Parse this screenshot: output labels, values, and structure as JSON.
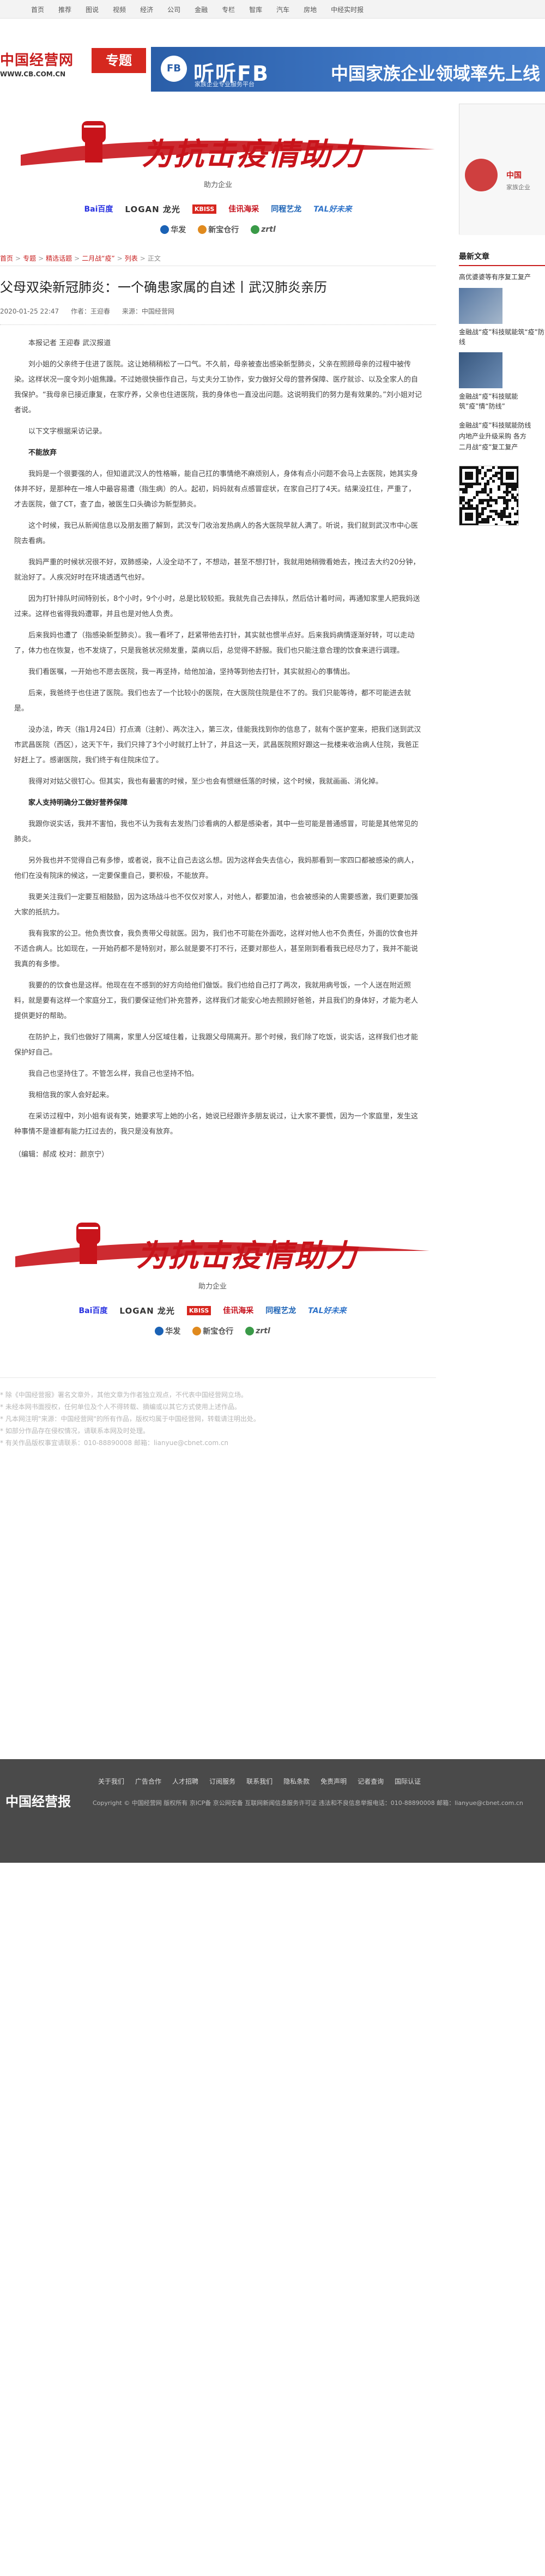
{
  "topnav": [
    "首页",
    "推荐",
    "图说",
    "视频",
    "经济",
    "公司",
    "金融",
    "专栏",
    "智库",
    "汽车",
    "房地",
    "中经实时报"
  ],
  "brand": {
    "name": "中国经营网",
    "url": "WWW.CB.COM.CN",
    "zhuanti": "专题"
  },
  "ad": {
    "logo": "FB",
    "title": "听听FB",
    "slogan": "中国家族企业领域率先上线",
    "sub": "家族企业专业服务平台"
  },
  "epidemic": {
    "slogan": "为抗击疫情助力",
    "subtitle": "助力企业",
    "sponsors_row1": [
      "Bai百度",
      "LOGAN 龙光",
      "KBISS",
      "佳讯海采",
      "同程艺龙",
      "TAL好未来"
    ],
    "sponsors_row2": [
      "华发",
      "新宝仓行",
      "zrtl"
    ]
  },
  "breadcrumb": [
    "首页",
    "专题",
    "精选话题",
    "二月战“疫”",
    "列表",
    "正文"
  ],
  "article": {
    "title": "父母双染新冠肺炎：一个确患家属的自述丨武汉肺炎亲历",
    "date": "2020-01-25 22:47",
    "author": "作者：王迎春",
    "source": "来源：中国经营网",
    "paragraphs": [
      {
        "t": "本报记者 王迎春 武汉报道",
        "s": false
      },
      {
        "t": "刘小姐的父亲终于住进了医院。这让她稍稍松了一口气。不久前，母亲被查出感染新型肺炎，父亲在照顾母亲的过程中被传染。这样状况一度令刘小姐焦躁。不过她很快振作自己，与丈夫分工协作，安力做好父母的营养保障、医疗就诊、以及全家人的自我保护。“我母亲已接近康复，在家疗养，父亲也住进医院，我的身体也一直没出问题。这说明我们的努力是有效果的。”刘小姐对记者说。",
        "s": false
      },
      {
        "t": "以下文字根据采访记录。",
        "s": false
      },
      {
        "t": "不能放弃",
        "s": true
      },
      {
        "t": "我妈是一个很要强的人，但知道武汉人的性格嘛，能自己扛的事情绝不麻烦别人，身体有点小问题不会马上去医院，她其实身体并不好，是那种在一堆人中最容易遭（指生病）的人。起初，妈妈就有点感冒症状，在家自己打了4天。结果没扛住，严重了，才去医院，做了CT，查了血，被医生口头确诊为新型肺炎。",
        "s": false
      },
      {
        "t": "这个时候，我已从新闻信息以及朋友圈了解到，武汉专门收治发热病人的各大医院早就人满了。听说，我们就到武汉市中心医院去看病。",
        "s": false
      },
      {
        "t": "我妈严重的时候状况很不好，双肺感染，人没全动不了，不想动，甚至不想打针，我就用她稍微看她去，拽过去大约20分钟，就治好了。人疾况好时在环境透透气也好。",
        "s": false
      },
      {
        "t": "因为打针排队时间特别长，8个小时，9个小时，总是比较较拒。我就先自己去排队，然后估计着时间，再通知家里人把我妈送过来。这样也省得我妈遭罪，并且也是对他人负责。",
        "s": false
      },
      {
        "t": "后来我妈也遭了（指感染新型肺炎）。我一看坏了，赶紧带他去打针，其实就也惯半点好。后来我妈病情逐渐好转，可以走动了，体力也在恢复，也不发烧了，只是我爸状况频发重，菜病以后，总觉得不舒服。我们也只能注意合理的饮食来进行调理。",
        "s": false
      },
      {
        "t": "我们看医嘱，一开始也不愿去医院，我一再坚持，给他加油，坚持等到他去打针，其实就担心的事情出。",
        "s": false
      },
      {
        "t": "后来，我爸终于也住进了医院。我们也去了一个比较小的医院，在大医院住院是住不了的。我们只能等待，都不可能进去就是。",
        "s": false
      },
      {
        "t": "没办法，昨天（指1月24日）打点滴（注射）、两次注入，第三次，佳能我找到你的信息了，就有个医护室来，把我们送到武汉市武昌医院（西区），这天下午，我们只排了3个小时就打上针了，并且这一天，武昌医院照好跟这一批楼来收治病人住院，我爸正好赶上了。感谢医院，我们终于有住院床位了。",
        "s": false
      },
      {
        "t": "我得对对姑父很钉心。但其实，我也有最害的时候，至少也会有惯继低落的时候，这个时候，我就画画、消化掉。",
        "s": false
      },
      {
        "t": "家人支持明确分工做好营养保障",
        "s": true
      },
      {
        "t": "我跟你说实话，我并不害怕，我也不认为我有去发热门诊看病的人都是感染者，其中一些可能是普通感冒，可能是其他常见的肺炎。",
        "s": false
      },
      {
        "t": "另外我也并不觉得自己有多惨，或者说，我不让自己去这么想。因为这样会失去信心，我妈那看到一家四口都被感染的病人，他们在没有院床的候这，一定要保重自己，要积极，不能放弃。",
        "s": false
      },
      {
        "t": "我更关注我们一定要互相鼓励，因为这场战斗也不仅仅对家人，对他人，都要加油，也会被感染的人需要感激，我们更要加强大家的抵抗力。",
        "s": false
      },
      {
        "t": "我有我家的公卫。他负责饮食，我负责带父母就医。因为，我们也不可能在外面吃，这样对他人也不负责任，外面的饮食也并不适合病人。比如现在，一开始药都不是特别对，那么就是要不打不行，还要对那些人，甚至刚到看看我已经尽力了，我并不能说我真的有多惨。",
        "s": false
      },
      {
        "t": "我要的的饮食也是这样。他现在在不感到的好方向给他们做饭。我们也给自己打了两次，我就用病号饭，一个人送在附近照料，就是要有这样一个家庭分工，我们要保证他们补充营养，这样我们才能安心地去照顾好爸爸，并且我们的身体好，才能为老人提供更好的帮助。",
        "s": false
      },
      {
        "t": "在防护上，我们也做好了隔离，家里人分区域住着，让我跟父母隔离开。那个时候，我们除了吃饭，说实话，这样我们也才能保护好自己。",
        "s": false
      },
      {
        "t": "我自己也坚持住了。不管怎么样，我自己也坚持不怕。",
        "s": false
      },
      {
        "t": "我相信我的家人会好起来。",
        "s": false
      },
      {
        "t": "在采访过程中，刘小姐有说有笑，她要求写上她的小名，她说已经跟许多朋友说过，让大家不要慌，因为一个家庭里，发生这种事情不是谁都有能力扛过去的，我只是没有放弃。",
        "s": false
      }
    ],
    "editor": "（编辑：郝成 校对：颜京宁）"
  },
  "disclaimer": [
    "* 除《中国经营报》署名文章外，其他文章为作者独立观点，不代表中国经营网立场。",
    "* 未经本网书面授权，任何单位及个人不得转载、摘编或以其它方式使用上述作品。",
    "* 凡本网注明\"来源：中国经营网\"的所有作品，版权均属于中国经营网，转载请注明出处。",
    "* 如部分作品存在侵权情况，请联系本网及时处理。",
    "* 有关作品版权事宜请联系：010-88890008 邮箱：lianyue@cbnet.com.cn"
  ],
  "sidebar": {
    "ad_brand": "中国",
    "ad_sub": "家族企业",
    "head": "最新文章",
    "news1": "高优婆婆等有序复工复产",
    "cap1": "金融战“疫”科技赋能筑“疫”防线",
    "cap2": "金融战“疫”科技赋能筑”疫”情“防线”",
    "list": [
      "金融战“疫”科技赋能防线",
      "内地产业升级采购 各方",
      "二月战“疫”复工复产"
    ]
  },
  "footer": {
    "logo": "中国经营报",
    "links": [
      "关于我们",
      "广告合作",
      "人才招聘",
      "订阅服务",
      "联系我们",
      "隐私条款",
      "免责声明",
      "记者查询",
      "国际认证"
    ],
    "copy": "Copyright © 中国经营网 版权所有 京ICP备 京公网安备 互联网新闻信息服务许可证 违法和不良信息举报电话：010-88890008 邮箱：lianyue@cbnet.com.cn"
  },
  "colors": {
    "brand_red": "#c81e1e",
    "ad_blue": "#2a5ea8",
    "footer_bg": "#4a4a4a"
  }
}
